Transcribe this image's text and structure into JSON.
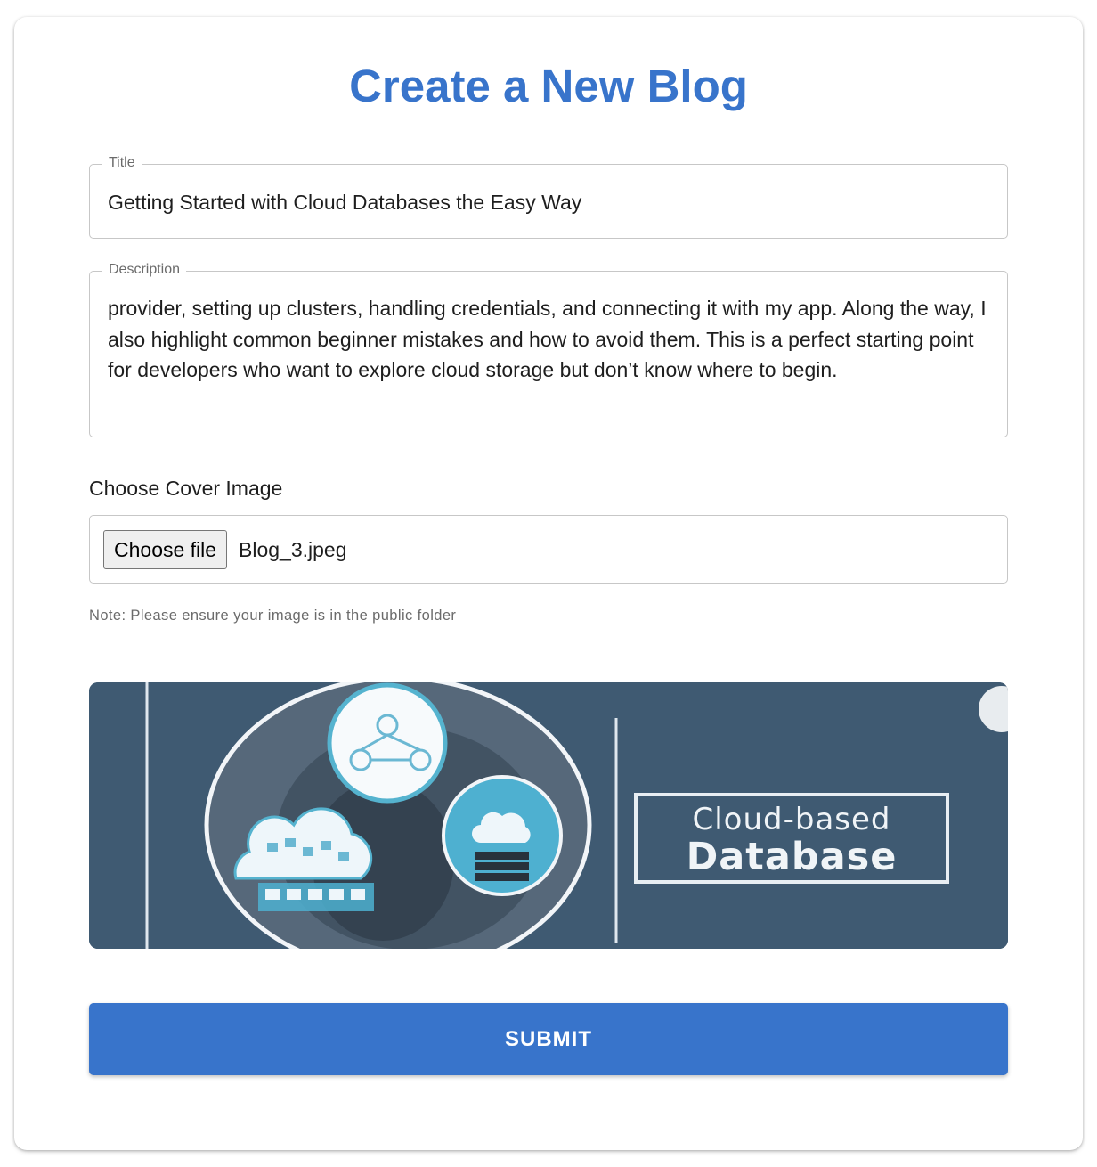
{
  "page": {
    "title": "Create a New Blog"
  },
  "form": {
    "title_field": {
      "label": "Title",
      "value": "Getting Started with Cloud Databases the Easy Way"
    },
    "description_field": {
      "label": "Description",
      "value": "provider, setting up clusters, handling credentials, and connecting it with my app. Along the way, I also highlight common beginner mistakes and how to avoid them. This is a perfect starting point for developers who want to explore cloud storage but don’t know where to begin."
    },
    "cover_image": {
      "label": "Choose Cover Image",
      "button_label": "Choose file",
      "file_name": "Blog_3.jpeg",
      "note": "Note: Please ensure your image is in the public folder"
    },
    "preview": {
      "line1": "Cloud-based",
      "line2": "Database"
    },
    "submit_label": "SUBMIT"
  },
  "colors": {
    "accent": "#3874cb",
    "preview_background": "#3f5a72"
  }
}
